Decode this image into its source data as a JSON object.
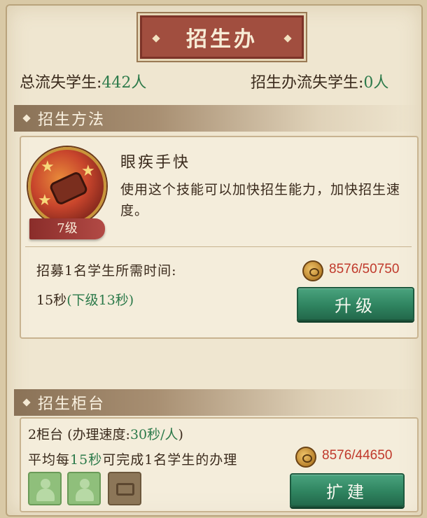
{
  "header": {
    "title": "招生办"
  },
  "stats": {
    "total_lost_label": "总流失学生:",
    "total_lost_value": "442人",
    "office_lost_label": "招生办流失学生:",
    "office_lost_value": "0人"
  },
  "method_section": {
    "title": "招生方法",
    "skill": {
      "name": "眼疾手快",
      "level": "7级",
      "description": "使用这个技能可以加快招生能力，加快招生速度。",
      "icon": "scroll-skill-icon"
    },
    "recruit_label": "招募1名学生所需时间:",
    "recruit_time": "15秒",
    "recruit_next": "(下级13秒)",
    "cost": "8576/50750",
    "upgrade_label": "升级"
  },
  "counter_section": {
    "title": "招生柜台",
    "counter_prefix": "2柜台 (办理速度:",
    "counter_speed": "30秒/人",
    "counter_suffix": ")",
    "avg_prefix": "平均每",
    "avg_seconds": "15秒",
    "avg_suffix": "可完成1名学生的办理",
    "cost": "8576/44650",
    "expand_label": "扩建",
    "slots": [
      "occupied",
      "occupied",
      "empty"
    ]
  },
  "colors": {
    "title_plate": "#a14e3f",
    "green_value": "#2c7a4a",
    "cost_red": "#c0392b",
    "button_green": "#2f8460"
  }
}
